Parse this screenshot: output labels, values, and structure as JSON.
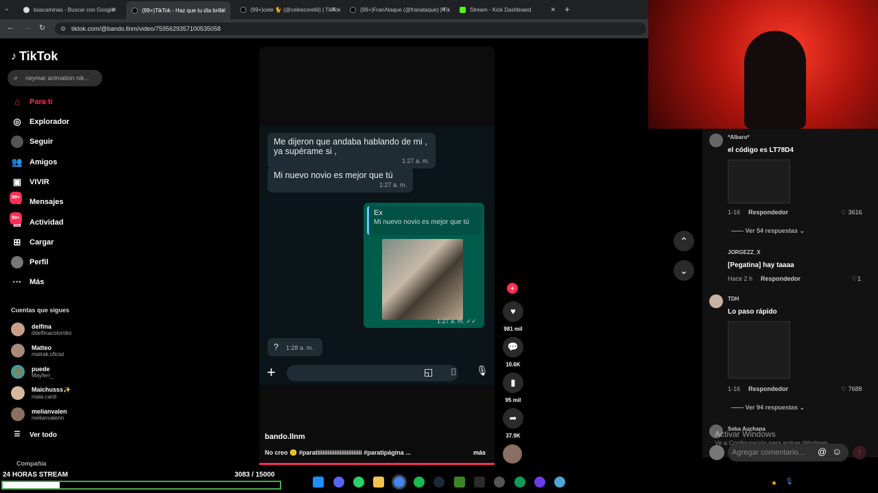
{
  "browser": {
    "tabs": [
      {
        "label": "buscaminas - Buscar con Google"
      },
      {
        "label": "(99+)TikTok - Haz que tu día brille"
      },
      {
        "label": "(99+)cele 🐈 (@celescorellii) | TikTok"
      },
      {
        "label": "(99+)FranAtaque (@franataque) | TikTok"
      },
      {
        "label": "Stream - Kick Dashboard"
      }
    ],
    "url": "tiktok.com/@bando.llnm/video/7595629357100535058"
  },
  "tiktok": {
    "logo": "TikTok",
    "search_placeholder": "neymar animation nik...",
    "nav": [
      {
        "label": "Para ti",
        "icon": "home-icon"
      },
      {
        "label": "Explorador",
        "icon": "compass-icon"
      },
      {
        "label": "Seguir",
        "icon": "following-icon"
      },
      {
        "label": "Amigos",
        "icon": "friends-icon"
      },
      {
        "label": "VIVIR",
        "icon": "live-icon"
      },
      {
        "label": "Mensajes",
        "icon": "messages-icon",
        "badge": "99+"
      },
      {
        "label": "Actividad",
        "icon": "activity-icon",
        "badge": "99+"
      },
      {
        "label": "Cargar",
        "icon": "upload-icon"
      },
      {
        "label": "Perfil",
        "icon": "profile-icon"
      },
      {
        "label": "Más",
        "icon": "more-icon"
      }
    ],
    "following_title": "Cuentas que sigues",
    "following": [
      {
        "name": "delfina",
        "handle": "ddelfinacolombo"
      },
      {
        "name": "Matteo",
        "handle": "matrak.oficial"
      },
      {
        "name": "puede",
        "handle": "Mayferr_"
      },
      {
        "name": "Maichusss✨",
        "handle": "mala.canti"
      },
      {
        "name": "melianvalen",
        "handle": "melianvalenn"
      }
    ],
    "see_all": "Ver todo",
    "company": "Compañía"
  },
  "video": {
    "messages": [
      {
        "text": "Me dijeron que andaba hablando de mi , ya supérame si ,",
        "time": "1:27 a. m."
      },
      {
        "text": "Mi nuevo novio es mejor que tú",
        "time": "1:27 a. m."
      }
    ],
    "reply": {
      "quote_author": "Ex",
      "quote_text": "Mi nuevo novio es mejor que tú",
      "time": "1:27 a. m. ✓✓"
    },
    "last": {
      "text": "?",
      "time": "1:28 a. m."
    },
    "username": "bando.llnm",
    "caption": "No creo 🙃 #paratiiiiiiiiiiiiiiiiiiiiiiiiii #paratipágina ...",
    "more": "más"
  },
  "actions": {
    "likes": "981 mil",
    "comments": "10.6K",
    "saves": "95 mil",
    "shares": "37.9K"
  },
  "comments": [
    {
      "user": "*Albaro*",
      "text": "el código es LT78D4",
      "date": "1-16",
      "reply": "Respondedor",
      "likes": "3616",
      "replies": "Ver 54 respuestas"
    },
    {
      "user": "JORGEZZ_X",
      "text": "[Pegatina] hay taaaa",
      "date": "Hace 2 h",
      "reply": "Respondedor",
      "likes": "1"
    },
    {
      "user": "TDH",
      "text": "Lo paso rápido",
      "date": "1-16",
      "reply": "Respondedor",
      "likes": "7688",
      "replies": "Ver 94 respuestas"
    },
    {
      "user": "Seba Auchana"
    }
  ],
  "comment_placeholder": "Agregar comentario...",
  "watermark": {
    "line1": "Activar Windows",
    "line2": "Ve a Configuración para activar Windows."
  },
  "stream": {
    "label": "24 HORAS STREAM",
    "count": "3083",
    "goal": "/ 15000",
    "progress": 0.2055
  }
}
